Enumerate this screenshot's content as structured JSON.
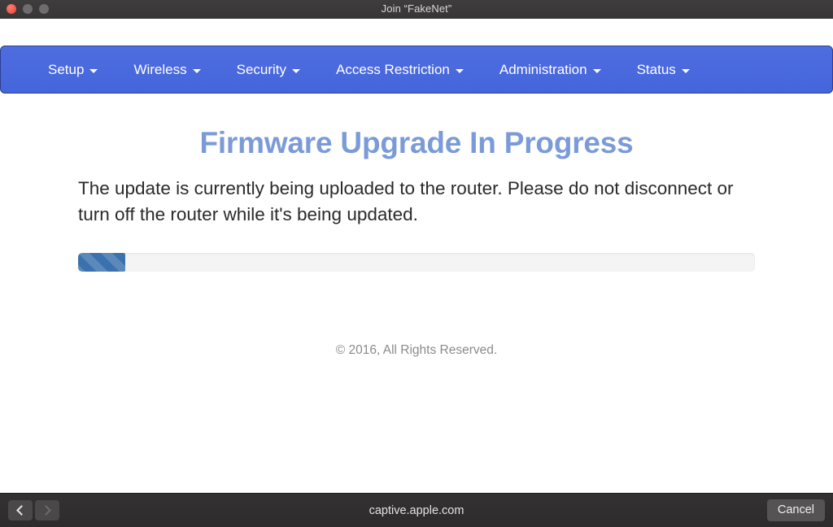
{
  "window": {
    "title": "Join “FakeNet”",
    "traffic_lights": [
      {
        "name": "close",
        "color": "#f05b4c"
      },
      {
        "name": "minimize",
        "color": "#6e6c6c"
      },
      {
        "name": "zoom",
        "color": "#6e6c6c"
      }
    ]
  },
  "navbar": {
    "background_color": "#4a6ae0",
    "items": [
      {
        "label": "Setup",
        "has_caret": true
      },
      {
        "label": "Wireless",
        "has_caret": true
      },
      {
        "label": "Security",
        "has_caret": true
      },
      {
        "label": "Access Restriction",
        "has_caret": true
      },
      {
        "label": "Administration",
        "has_caret": true
      },
      {
        "label": "Status",
        "has_caret": true
      }
    ]
  },
  "content": {
    "heading": "Firmware Upgrade In Progress",
    "heading_color": "#7b9bd8",
    "description": "The update is currently being uploaded to the router. Please do not disconnect or turn off the router while it's being updated.",
    "progress": {
      "percent": 7,
      "fill_color": "#3b72ad",
      "track_color": "#f4f4f4",
      "striped": true
    },
    "copyright": "© 2016, All Rights Reserved."
  },
  "toolbar": {
    "back_label": "‹",
    "forward_label": "›",
    "url": "captive.apple.com",
    "cancel_label": "Cancel"
  }
}
